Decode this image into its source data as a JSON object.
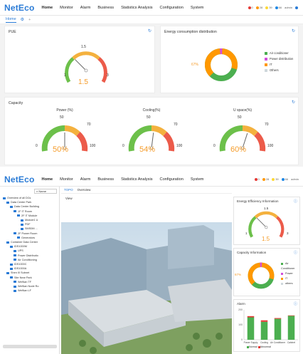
{
  "app": {
    "logo": "NetEco"
  },
  "top1": {
    "nav": [
      "Home",
      "Monitor",
      "Alarm",
      "Business",
      "Statistics Analysis",
      "Configuration",
      "System"
    ],
    "status": [
      {
        "count": "0",
        "color": "#e53935"
      },
      {
        "count": "28",
        "color": "#ff9800"
      },
      {
        "count": "39",
        "color": "#fdd835"
      },
      {
        "count": "66",
        "color": "#1e88e5"
      }
    ],
    "user": "admin"
  },
  "subbar": {
    "home": "Home"
  },
  "pue": {
    "title": "PUE",
    "value": "1.5",
    "min": "1",
    "mid": "1.5",
    "max": "3",
    "level": 0.25
  },
  "energy": {
    "title": "Energy consumption distribution",
    "percent": "67%",
    "legend": [
      {
        "label": "Air conditioner",
        "color": "#4caf50"
      },
      {
        "label": "Power distribution",
        "color": "#d34ddb"
      },
      {
        "label": "IT",
        "color": "#ff9800"
      },
      {
        "label": "Others",
        "color": "#cfd8dc"
      }
    ]
  },
  "capacity": {
    "title": "Capacity",
    "gauges": [
      {
        "label": "Power (%)",
        "value": "50%",
        "min": "0",
        "mid": "50",
        "warn": "70",
        "max": "100",
        "level": 0.5
      },
      {
        "label": "Cooling(%)",
        "value": "54%",
        "min": "0",
        "mid": "50",
        "warn": "70",
        "max": "100",
        "level": 0.54
      },
      {
        "label": "U space(%)",
        "value": "60%",
        "min": "0",
        "mid": "50",
        "warn": "70",
        "max": "100",
        "level": 0.6
      }
    ]
  },
  "top2": {
    "nav": [
      "Home",
      "Monitor",
      "Alarm",
      "Business",
      "Statistics Analysis",
      "Configuration",
      "System"
    ],
    "status": [
      {
        "count": "0",
        "color": "#e53935"
      },
      {
        "count": "28",
        "color": "#ff9800"
      },
      {
        "count": "39",
        "color": "#fdd835"
      },
      {
        "count": "66",
        "color": "#1e88e5"
      }
    ],
    "user": "admin"
  },
  "tree": {
    "search": "Name",
    "items": [
      {
        "label": "Overview of all DCs",
        "indent": 0
      },
      {
        "label": "Data Center Park",
        "indent": 1
      },
      {
        "label": "Data Center Building",
        "indent": 2
      },
      {
        "label": "1F IT Room",
        "indent": 3
      },
      {
        "label": "2F IT Module",
        "indent": 4
      },
      {
        "label": "Module1 U",
        "indent": 5
      },
      {
        "label": "PDF",
        "indent": 5
      },
      {
        "label": "SMS0M ...",
        "indent": 5
      },
      {
        "label": "2F Power Room",
        "indent": 3
      },
      {
        "label": "Generators",
        "indent": 4
      },
      {
        "label": "Container Data Center",
        "indent": 1
      },
      {
        "label": "IDS1000M",
        "indent": 2
      },
      {
        "label": "UPS",
        "indent": 3
      },
      {
        "label": "Power Distributio",
        "indent": 3
      },
      {
        "label": "Air Conditioning",
        "indent": 3
      },
      {
        "label": "IDS1000C",
        "indent": 2
      },
      {
        "label": "IDS1000A",
        "indent": 2
      },
      {
        "label": "Shen III Subnet",
        "indent": 1
      },
      {
        "label": "Site Near Park",
        "indent": 2
      },
      {
        "label": "WeiNan TF",
        "indent": 3
      },
      {
        "label": "WeiNan Node Ro",
        "indent": 3
      },
      {
        "label": "WeiNan LF",
        "indent": 3
      }
    ]
  },
  "tabs": [
    "TOPO",
    "Overview"
  ],
  "view": {
    "label": "View"
  },
  "eff": {
    "title": "Energy Efficiency Information",
    "value": "1.5",
    "min": "1",
    "mid": "1.5",
    "max": "3",
    "level": 0.25
  },
  "capinfo": {
    "title": "Capacity Information",
    "percent": "67%",
    "legend": [
      {
        "label": "Air Conditioner",
        "color": "#4caf50"
      },
      {
        "label": "Power",
        "color": "#d34ddb"
      },
      {
        "label": "IT",
        "color": "#ff9800"
      },
      {
        "label": "others",
        "color": "#cfd8dc"
      }
    ]
  },
  "alarm": {
    "title": "Alarm",
    "yticks": [
      "0",
      "100",
      "200"
    ],
    "categories": [
      "Power Supply",
      "Cooling",
      "Air Conditioner",
      "Cabinet"
    ],
    "legend": [
      "Normal",
      "Abnormal"
    ]
  },
  "chart_data": {
    "type": "bar",
    "categories": [
      "Power Supply",
      "Cooling",
      "Air Conditioner",
      "Cabinet"
    ],
    "series": [
      {
        "name": "Normal",
        "values": [
          150,
          120,
          140,
          160
        ]
      },
      {
        "name": "Abnormal",
        "values": [
          8,
          10,
          5,
          3
        ]
      }
    ],
    "ylim": [
      0,
      200
    ],
    "colors": [
      "#4caf50",
      "#e53935"
    ]
  }
}
